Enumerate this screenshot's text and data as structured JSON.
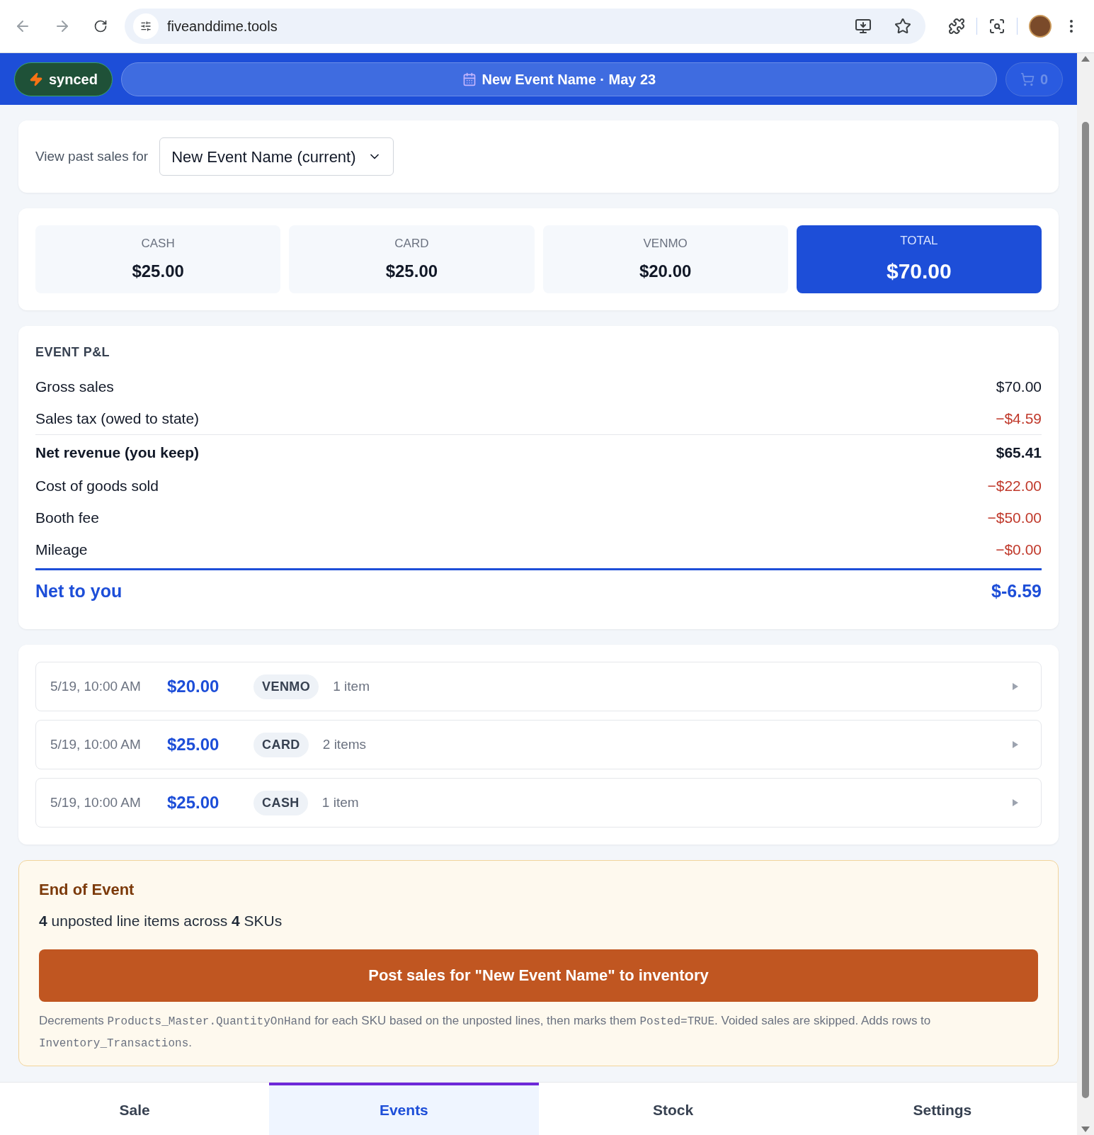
{
  "browser": {
    "url": "fiveanddime.tools"
  },
  "header": {
    "sync": {
      "label": "synced"
    },
    "event": {
      "title": "New Event Name · May 23"
    },
    "cart": {
      "count": "0",
      "disabled": true
    }
  },
  "event_picker": {
    "label": "View past sales for",
    "value": "New Event Name (current)"
  },
  "totals": [
    {
      "label": "CASH",
      "amount": "$25.00",
      "kind": "method"
    },
    {
      "label": "CARD",
      "amount": "$25.00",
      "kind": "method"
    },
    {
      "label": "VENMO",
      "amount": "$20.00",
      "kind": "method"
    },
    {
      "label": "TOTAL",
      "amount": "$70.00",
      "kind": "total"
    }
  ],
  "pnl": {
    "title": "EVENT P&L",
    "rows": [
      {
        "label": "Gross sales",
        "value": "$70.00",
        "kind": "plain"
      },
      {
        "label": "Sales tax (owed to state)",
        "value": "−$4.59",
        "kind": "deduction"
      },
      {
        "label": "Net revenue (you keep)",
        "value": "$65.41",
        "kind": "subtotal"
      },
      {
        "label": "Cost of goods sold",
        "value": "−$22.00",
        "kind": "deduction"
      },
      {
        "label": "Booth fee",
        "value": "−$50.00",
        "kind": "deduction"
      },
      {
        "label": "Mileage",
        "value": "−$0.00",
        "kind": "deduction"
      },
      {
        "label": "Net to you",
        "value": "$-6.59",
        "kind": "total"
      }
    ]
  },
  "sales": [
    {
      "time": "5/19, 10:00 AM",
      "amount": "$20.00",
      "method": "VENMO",
      "items": "1 item"
    },
    {
      "time": "5/19, 10:00 AM",
      "amount": "$25.00",
      "method": "CARD",
      "items": "2 items"
    },
    {
      "time": "5/19, 10:00 AM",
      "amount": "$25.00",
      "method": "CASH",
      "items": "1 item"
    }
  ],
  "end_of_event": {
    "title": "End of Event",
    "summary": "**4** unposted line items across **4** SKUs",
    "button": "Post sales for \"New Event Name\" to inventory",
    "note": [
      {
        "kind": "text",
        "text": "Decrements "
      },
      {
        "kind": "code",
        "text": "Products_Master.QuantityOnHand"
      },
      {
        "kind": "text",
        "text": " for each SKU based on the unposted lines, then marks them "
      },
      {
        "kind": "code",
        "text": "Posted=TRUE"
      },
      {
        "kind": "text",
        "text": ". Voided sales are skipped. Adds rows to "
      },
      {
        "kind": "code",
        "text": "Inventory_Transactions"
      },
      {
        "kind": "text",
        "text": "."
      }
    ]
  },
  "tabs": [
    {
      "label": "Sale",
      "selected": false
    },
    {
      "label": "Events",
      "selected": true
    },
    {
      "label": "Stock",
      "selected": false
    },
    {
      "label": "Settings",
      "selected": false
    }
  ]
}
